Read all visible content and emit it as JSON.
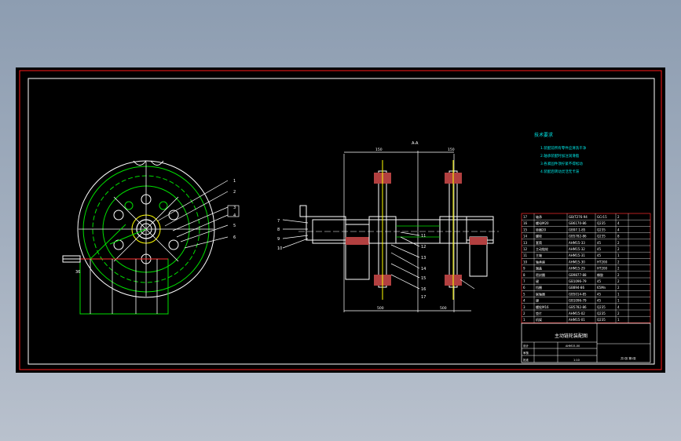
{
  "drawing": {
    "section_label": "A-A",
    "tech_req_title": "技术要求",
    "tech_req_lines": [
      "1.装配前所有零件应清洗干净",
      "2.轴承装配时加注润滑脂",
      "3.各紧固件须拧紧不得松动",
      "4.装配后转动灵活无卡滞"
    ],
    "left_view_callouts": [
      "1",
      "2",
      "3",
      "4",
      "5",
      "6"
    ],
    "section_callouts_left": [
      "7",
      "8",
      "9",
      "10"
    ],
    "section_callouts_right": [
      "11",
      "12",
      "13",
      "14",
      "15",
      "16",
      "17"
    ],
    "dimensions": {
      "top_left": "150",
      "top_right": "150",
      "bottom_left": "500",
      "bottom_right": "500",
      "left_height": "36"
    },
    "bom_rows": [
      {
        "no": "17",
        "name": "轴承",
        "code": "GB/T276-94",
        "mat": "GCr15",
        "qty": "2"
      },
      {
        "no": "16",
        "name": "螺母M20",
        "code": "GB6170-86",
        "mat": "Q235",
        "qty": "4"
      },
      {
        "no": "15",
        "name": "垫圈20",
        "code": "GB97.1-85",
        "mat": "Q235",
        "qty": "4"
      },
      {
        "no": "14",
        "name": "螺栓",
        "code": "GB5782-86",
        "mat": "Q235",
        "qty": "8"
      },
      {
        "no": "13",
        "name": "套筒",
        "code": "AHM15-33",
        "mat": "45",
        "qty": "2"
      },
      {
        "no": "12",
        "name": "主动链轮",
        "code": "AHM15-32",
        "mat": "45",
        "qty": "2"
      },
      {
        "no": "11",
        "name": "主轴",
        "code": "AHM15-31",
        "mat": "45",
        "qty": "1"
      },
      {
        "no": "10",
        "name": "轴承座",
        "code": "AHM15-30",
        "mat": "HT200",
        "qty": "2"
      },
      {
        "no": "9",
        "name": "端盖",
        "code": "AHM15-29",
        "mat": "HT200",
        "qty": "2"
      },
      {
        "no": "8",
        "name": "密封圈",
        "code": "GB9877-88",
        "mat": "橡胶",
        "qty": "2"
      },
      {
        "no": "7",
        "name": "键",
        "code": "GB1096-79",
        "mat": "45",
        "qty": "2"
      },
      {
        "no": "6",
        "name": "挡圈",
        "code": "GB894-86",
        "mat": "65Mn",
        "qty": "2"
      },
      {
        "no": "5",
        "name": "联轴器",
        "code": "GB5014-85",
        "mat": "45",
        "qty": "1"
      },
      {
        "no": "4",
        "name": "键",
        "code": "GB1096-79",
        "mat": "45",
        "qty": "1"
      },
      {
        "no": "3",
        "name": "螺栓M16",
        "code": "GB5782-86",
        "mat": "Q235",
        "qty": "4"
      },
      {
        "no": "2",
        "name": "垫片",
        "code": "AHM15-02",
        "mat": "Q235",
        "qty": "2"
      },
      {
        "no": "1",
        "name": "机架",
        "code": "AHM15-01",
        "mat": "Q235",
        "qty": "1"
      }
    ],
    "title_block": {
      "drawing_name": "主动链轮装配图",
      "drawing_no": "AHM15-00",
      "scale": "1:10",
      "weight": "",
      "sheet": "共1张 第1张",
      "designer": "设计",
      "checker": "审核",
      "approver": "批准"
    }
  }
}
